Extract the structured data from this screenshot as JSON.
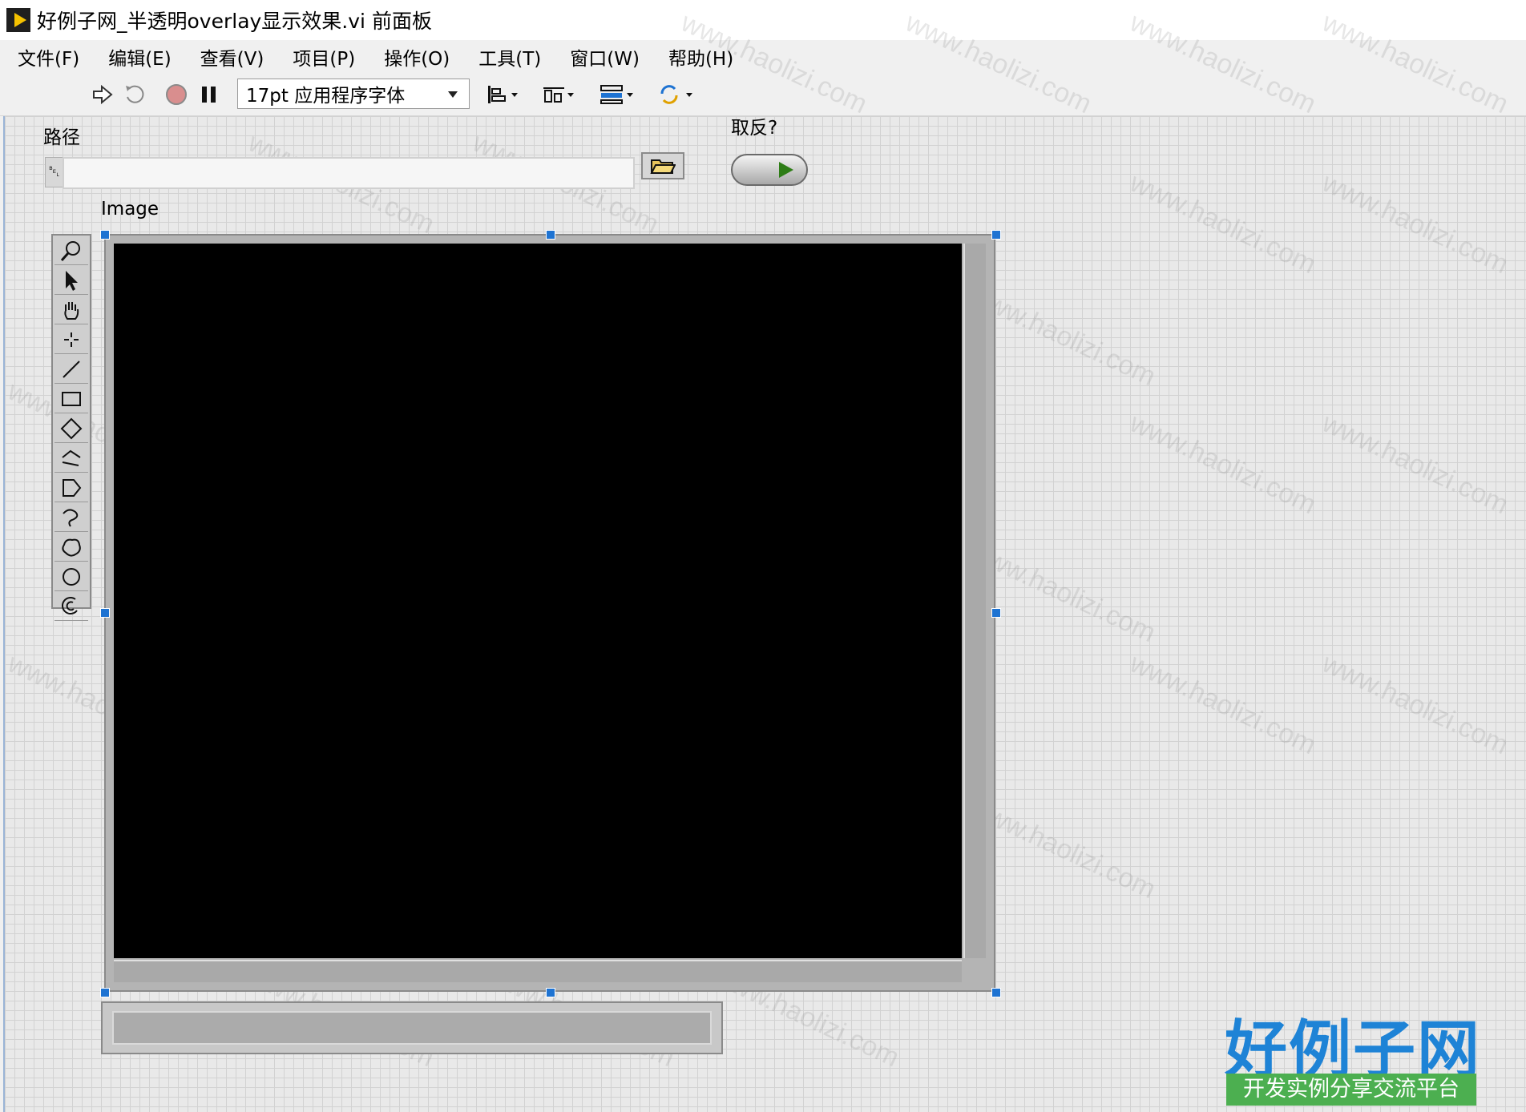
{
  "window": {
    "title": "好例子网_半透明overlay显示效果.vi 前面板"
  },
  "menu": [
    "文件(F)",
    "编辑(E)",
    "查看(V)",
    "项目(P)",
    "操作(O)",
    "工具(T)",
    "窗口(W)",
    "帮助(H)"
  ],
  "toolbar": {
    "font": "17pt 应用程序字体",
    "icons": [
      "run-arrow-icon",
      "run-continuously-icon",
      "abort-icon",
      "pause-icon",
      "align-objects-icon",
      "distribute-objects-icon",
      "resize-objects-icon",
      "reorder-icon"
    ]
  },
  "controls": {
    "path_label": "路径",
    "path_value": "",
    "path_tag": "␇",
    "invert_label": "取反?",
    "image_label": "Image"
  },
  "palette": {
    "tools": [
      "zoom-tool-icon",
      "selection-arrow-icon",
      "pan-hand-icon",
      "point-tool-icon",
      "line-tool-icon",
      "rectangle-tool-icon",
      "rotated-rectangle-icon",
      "polyline-tool-icon",
      "polygon-tool-icon",
      "freehand-line-icon",
      "freehand-region-icon",
      "oval-tool-icon",
      "annulus-tool-icon"
    ]
  },
  "watermark": "www.haolizi.com",
  "logo": {
    "main": "好例子网",
    "sub": "开发实例分享交流平台"
  },
  "colors": {
    "logo_blue": "#1e83d6",
    "logo_green": "#4caf50",
    "selection_handle": "#1e73d2"
  }
}
